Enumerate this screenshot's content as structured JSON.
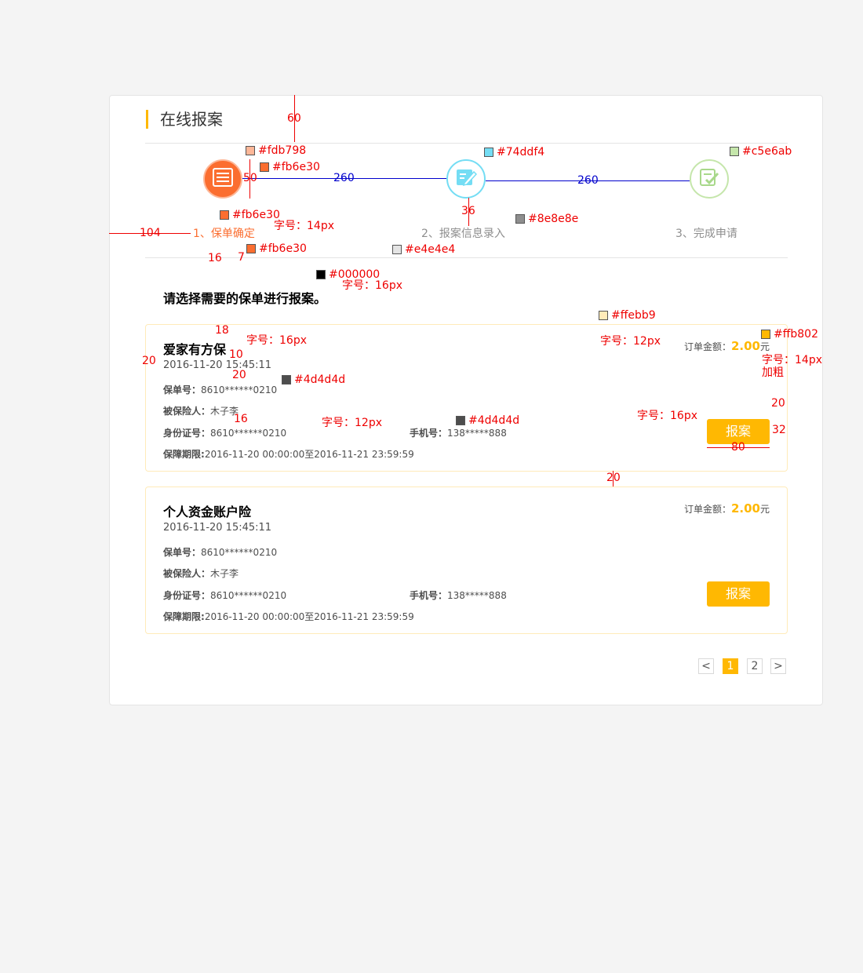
{
  "page": {
    "title": "在线报案"
  },
  "steps": [
    {
      "label": "1、保单确定",
      "color": "#fb6e30",
      "icon": "policy-document-icon"
    },
    {
      "label": "2、报案信息录入",
      "color": "#74ddf4",
      "icon": "edit-form-icon"
    },
    {
      "label": "3、完成申请",
      "color": "#c5e6ab",
      "icon": "check-document-icon"
    }
  ],
  "prompt": "请选择需要的保单进行报案。",
  "policies": [
    {
      "name": "爱家有方保",
      "time": "2016-11-20  15:45:11",
      "amount_label": "订单金额：",
      "amount": "2.00",
      "amount_unit": "元",
      "policy_no_label": "保单号：",
      "policy_no": "8610******0210",
      "insured_label": "被保险人：",
      "insured": "木子李",
      "id_label": "身份证号：",
      "id_no": "8610******0210",
      "phone_label": "手机号：",
      "phone": "138*****888",
      "period_label": "保障期限:",
      "period": "2016-11-20  00:00:00至2016-11-21  23:59:59",
      "button": "报案"
    },
    {
      "name": "个人资金账户险",
      "time": "2016-11-20  15:45:11",
      "amount_label": "订单金额：",
      "amount": "2.00",
      "amount_unit": "元",
      "policy_no_label": "保单号：",
      "policy_no": "8610******0210",
      "insured_label": "被保险人：",
      "insured": "木子李",
      "id_label": "身份证号：",
      "id_no": "8610******0210",
      "phone_label": "手机号：",
      "phone": "138*****888",
      "period_label": "保障期限:",
      "period": "2016-11-20  00:00:00至2016-11-21  23:59:59",
      "button": "报案"
    }
  ],
  "pager": {
    "prev": "<",
    "pages": [
      "1",
      "2"
    ],
    "next": ">",
    "current": "1"
  },
  "colors": {
    "accent": "#ffb802",
    "step1": "#fb6e30",
    "step1_light": "#fdb798",
    "step2": "#74ddf4",
    "step3": "#c5e6ab",
    "inactive_text": "#8e8e8e",
    "divider": "#e4e4e4",
    "card_border": "#ffebb9",
    "text": "#4d4d4d",
    "black": "#000000"
  },
  "annotations": {
    "d60": "60",
    "c_fdb798": "#fdb798",
    "c_fb6e30_a": "#fb6e30",
    "d50": "50",
    "d260_a": "260",
    "d260_b": "260",
    "c_74ddf4": "#74ddf4",
    "c_c5e6ab": "#c5e6ab",
    "d36": "36",
    "c_8e8e8e": "#8e8e8e",
    "c_fb6e30_b": "#fb6e30",
    "fs14": "字号：14px",
    "d104": "104",
    "d16_a": "16",
    "d7": "7",
    "c_fb6e30_c": "#fb6e30",
    "c_e4e4e4": "#e4e4e4",
    "c_000000": "#000000",
    "fs16_a": "字号：16px",
    "c_ffebb9": "#ffebb9",
    "d18": "18",
    "fs16_b": "字号：16px",
    "fs12_a": "字号：12px",
    "c_ffb802": "#ffb802",
    "d20_a": "20",
    "d10": "10",
    "d20_b": "20",
    "fs14_bold": "字号：14px",
    "bold": "加粗",
    "c_4d4d4d_a": "#4d4d4d",
    "d20_c": "20",
    "d16_b": "16",
    "fs12_b": "字号：12px",
    "c_4d4d4d_b": "#4d4d4d",
    "fs16_c": "字号：16px",
    "d32": "32",
    "d80": "80",
    "d20_d": "20"
  }
}
